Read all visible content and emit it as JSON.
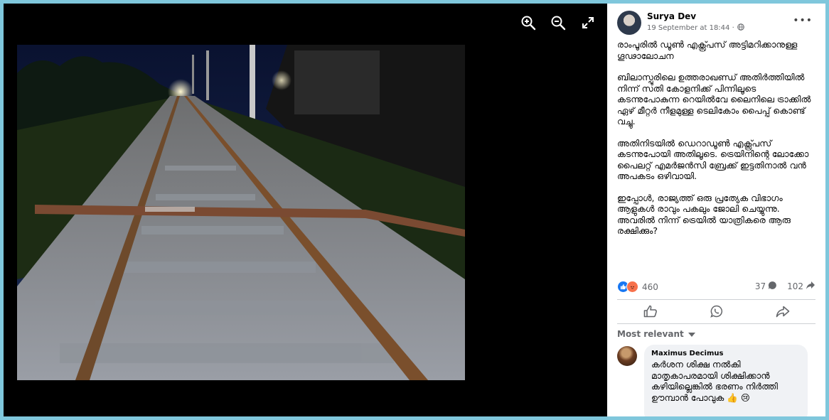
{
  "viewer": {
    "photo_alt": "Iron pipe placed across a railway track at night",
    "tools": [
      {
        "name": "zoom-in-icon"
      },
      {
        "name": "zoom-out-icon"
      },
      {
        "name": "fullscreen-icon"
      }
    ]
  },
  "post": {
    "author": "Surya Dev",
    "timestamp": "19 September at 18:44 ·",
    "privacy_icon": "globe-icon",
    "more_label": "•••",
    "paragraphs": [
      "രാംപൂരിൽ ഡൂൺ എക്സ്പ്രസ് അട്ടിമറിക്കാനുള്ള ഗൂഢാലോചന",
      "ബിലാസ്പൂരിലെ ഉത്തരാഖണ്ഡ് അതിർത്തിയിൽ നിന്ന് സതി കോളനിക്ക് പിന്നിലൂടെ കടന്നുപോകുന്ന റെയിൽവേ ലൈനിലെ ട്രാക്കിൽ ഏഴ് മീറ്റർ നീളമുള്ള ടെലികോം പൈപ്പ് കൊണ്ട് വച്ചു.",
      "അതിനിടയിൽ ഡെറാഡൂൺ എക്സ്പ്രസ് കടന്നുപോയി അതിലൂടെ. ട്രെയിനിന്റെ ലോക്കോ പൈലറ്റ് എമർജൻസി ബ്രേക്ക് ഇട്ടതിനാൽ വൻ അപകടം ഒഴിവായി.",
      "ഇപ്പോൾ, രാജ്യത്ത് ഒരു പ്രത്യേക വിഭാഗം ആളുകൾ രാവും പകലും ജോലി ചെയ്യുന്നു. അവരിൽ നിന്ന് ട്രെയിൽ യാത്രികരെ ആരു രക്ഷിക്കും?"
    ],
    "reaction_count": "460",
    "comment_count": "37",
    "share_count": "102",
    "sort_label": "Most relevant"
  },
  "comment": {
    "author": "Maximus Decimus",
    "text": "കർശന ശിക്ഷ നൽകി മാതൃകാപരമായി ശിക്ഷിക്കാൻ കഴിയില്ലെങ്കിൽ ഭരണം നിർത്തി ഊമ്പാൻ പോവുക 👍 😢"
  },
  "colors": {
    "like_blue": "#1877f2",
    "angry_orange": "#f7714b",
    "secondary_text": "#65676b",
    "comment_bg": "#f0f2f5"
  }
}
